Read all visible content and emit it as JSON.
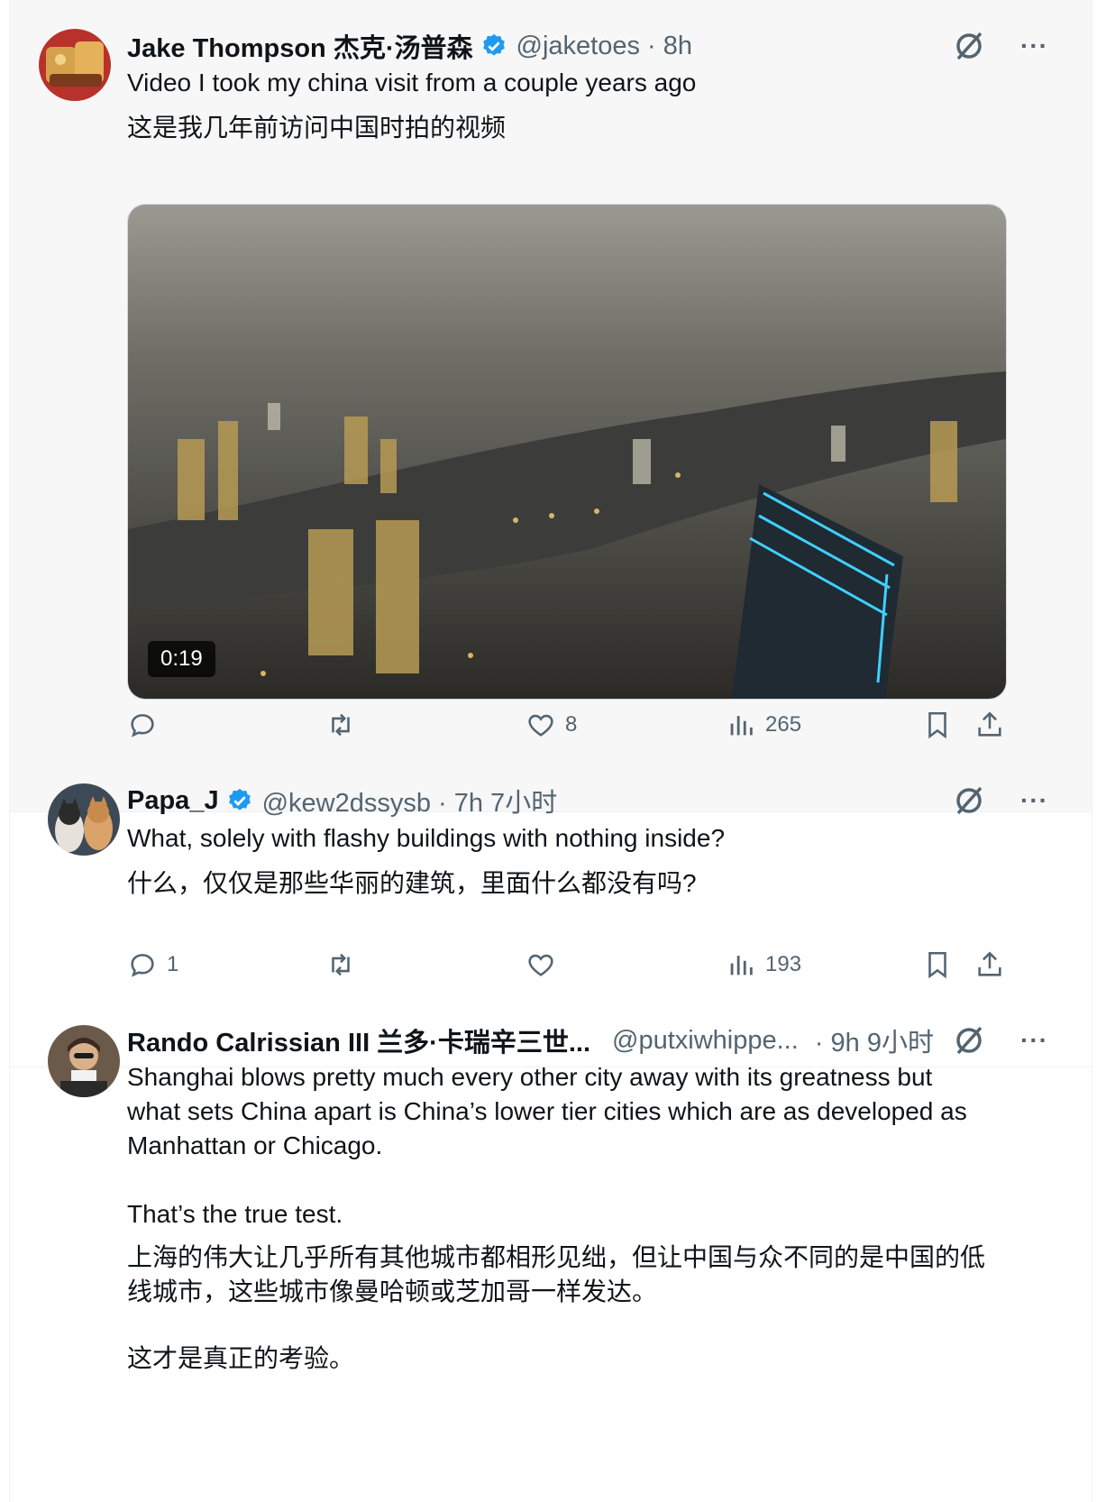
{
  "tweets": [
    {
      "name": "Jake Thompson 杰克·汤普森",
      "handle": "@jaketoes · 8h",
      "text_en": "Video I took my china visit from a couple years ago",
      "text_zh": "这是我几年前访问中国时拍的视频",
      "video_duration": "0:19",
      "actions": {
        "replies": "",
        "retweets": "",
        "likes": "8",
        "views": "265"
      }
    },
    {
      "name": "Papa_J",
      "handle": "@kew2dssysb · 7h 7小时",
      "text_en": "What, solely with flashy buildings with nothing inside?",
      "text_zh": "什么，仅仅是那些华丽的建筑，里面什么都没有吗?",
      "actions": {
        "replies": "1",
        "retweets": "",
        "likes": "",
        "views": "193"
      }
    },
    {
      "name": "Rando Calrissian III 兰多·卡瑞辛三世...",
      "handle": "@putxiwhippe...",
      "time": "· 9h 9小时",
      "text_en_1": "Shanghai blows pretty much every other city away with its greatness but what sets China apart is China’s lower tier cities which are as developed as Manhattan or Chicago.",
      "text_en_2": "That’s the true test.",
      "text_zh_1": "上海的伟大让几乎所有其他城市都相形见绌，但让中国与众不同的是中国的低线城市，这些城市像曼哈顿或芝加哥一样发达。",
      "text_zh_2": "这才是真正的考验。"
    }
  ],
  "more_label": "···",
  "colors": {
    "verified": "#1d9bf0",
    "muted": "#536471",
    "text": "#0f1419"
  }
}
